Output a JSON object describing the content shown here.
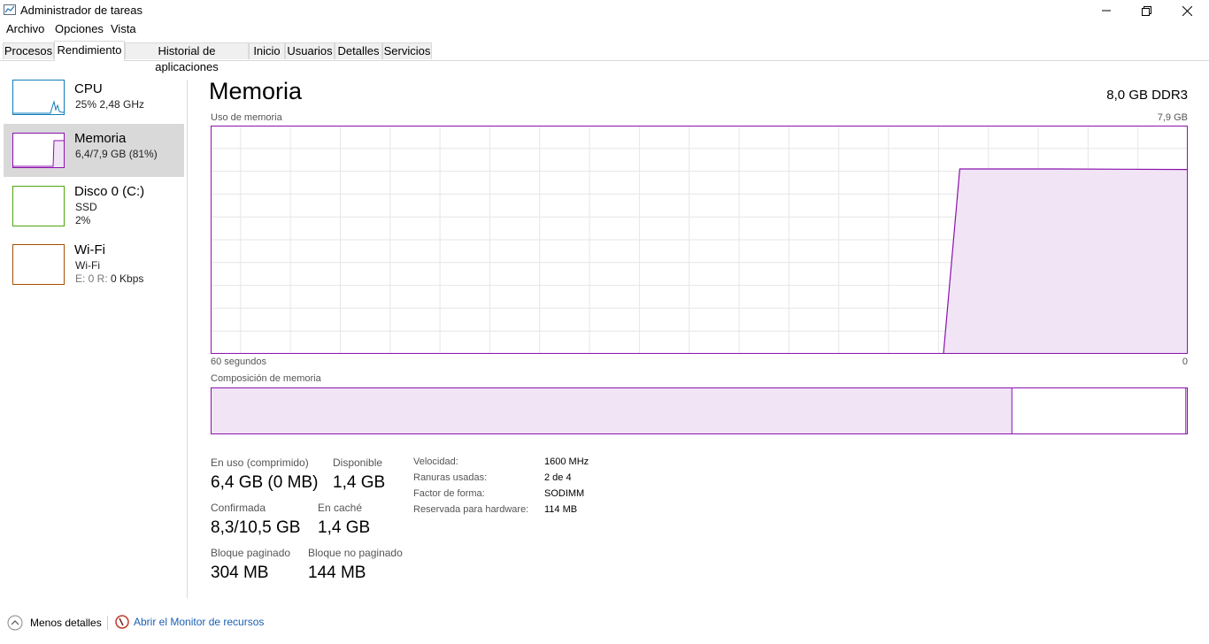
{
  "window": {
    "title": "Administrador de tareas"
  },
  "menu": [
    "Archivo",
    "Opciones",
    "Vista"
  ],
  "tabs": [
    "Procesos",
    "Rendimiento",
    "Historial de aplicaciones",
    "Inicio",
    "Usuarios",
    "Detalles",
    "Servicios"
  ],
  "active_tab": "Rendimiento",
  "sidebar": {
    "cpu": {
      "title": "CPU",
      "sub": "25%  2,48 GHz",
      "color": "#117dbb"
    },
    "memory": {
      "title": "Memoria",
      "sub": "6,4/7,9 GB (81%)",
      "color": "#8b12ae"
    },
    "disk": {
      "title": "Disco 0 (C:)",
      "sub1": "SSD",
      "sub2": "2%",
      "color": "#4da60c"
    },
    "wifi": {
      "title": "Wi-Fi",
      "sub1": "Wi-Fi",
      "sub2_prefix": "E: 0  R: ",
      "sub2_value": "0 Kbps",
      "color": "#a74f01"
    }
  },
  "main": {
    "title": "Memoria",
    "spec": "8,0 GB DDR3",
    "usage_label": "Uso de memoria",
    "usage_max": "7,9 GB",
    "time_left": "60 segundos",
    "time_right": "0",
    "composition_label": "Composición de memoria"
  },
  "graph_data": {
    "samples": [
      {
        "t": 60,
        "gb": 0
      },
      {
        "t": 15,
        "gb": 0
      },
      {
        "t": 14,
        "gb": 6.4
      },
      {
        "t": 8,
        "gb": 6.4
      },
      {
        "t": 0,
        "gb": 6.38
      }
    ],
    "max_gb": 7.9
  },
  "composition": {
    "in_use_fraction": 0.82,
    "standby_fraction": 0.178
  },
  "stats": {
    "in_use_label": "En uso (comprimido)",
    "in_use_value": "6,4 GB (0 MB)",
    "available_label": "Disponible",
    "available_value": "1,4 GB",
    "committed_label": "Confirmada",
    "committed_value": "8,3/10,5 GB",
    "cached_label": "En caché",
    "cached_value": "1,4 GB",
    "paged_label": "Bloque paginado",
    "paged_value": "304 MB",
    "nonpaged_label": "Bloque no paginado",
    "nonpaged_value": "144 MB"
  },
  "info": {
    "speed_label": "Velocidad:",
    "speed_value": "1600 MHz",
    "slots_label": "Ranuras usadas:",
    "slots_value": "2 de 4",
    "form_label": "Factor de forma:",
    "form_value": "SODIMM",
    "reserved_label": "Reservada para hardware:",
    "reserved_value": "114 MB"
  },
  "footer": {
    "fewer_details": "Menos detalles",
    "resource_monitor": "Abrir el Monitor de recursos"
  },
  "icons": [
    "task-manager-icon",
    "minimize-icon",
    "maximize-icon",
    "close-icon",
    "chevron-up-icon",
    "resource-monitor-icon"
  ]
}
